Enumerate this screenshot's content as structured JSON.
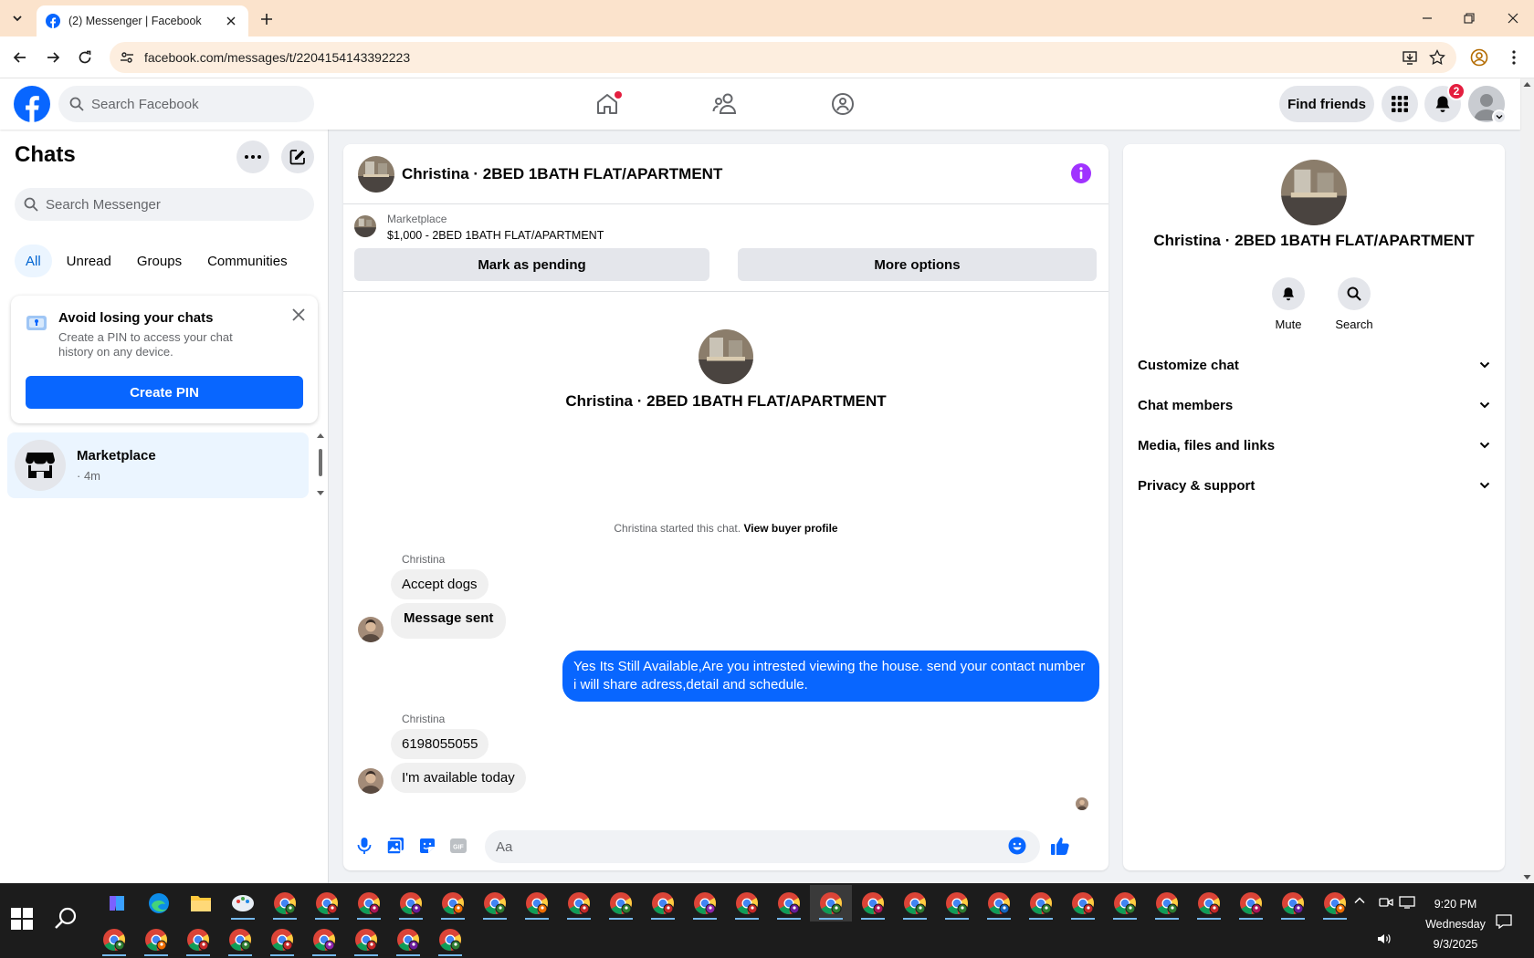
{
  "browser": {
    "tab_title": "(2) Messenger | Facebook",
    "url": "facebook.com/messages/t/2204154143392223"
  },
  "fb_header": {
    "search_placeholder": "Search Facebook",
    "find_friends": "Find friends",
    "notification_count": "2"
  },
  "chats": {
    "title": "Chats",
    "search_placeholder": "Search Messenger",
    "filters": [
      "All",
      "Unread",
      "Groups",
      "Communities"
    ],
    "pin_card": {
      "title": "Avoid losing your chats",
      "description": "Create a PIN to access your chat history on any device.",
      "button": "Create PIN"
    },
    "conversations": [
      {
        "name": "Marketplace",
        "time": "· 4m"
      }
    ]
  },
  "chat": {
    "header_name": "Christina · 2BED 1BATH FLAT/APARTMENT",
    "marketplace_label": "Marketplace",
    "listing": "$1,000 - 2BED 1BATH FLAT/APARTMENT",
    "mark_pending": "Mark as pending",
    "more_options": "More options",
    "intro_name": "Christina · 2BED 1BATH FLAT/APARTMENT",
    "started_text": "Christina started this chat.",
    "view_profile": "View buyer profile",
    "messages": [
      {
        "sender": "Christina",
        "text": "Accept dogs"
      },
      {
        "text": "Message sent"
      },
      {
        "outgoing": true,
        "text": "Yes Its Still Available,Are you intrested viewing the house. send your contact number i will share adress,detail and schedule."
      },
      {
        "sender": "Christina",
        "text": "6198055055"
      },
      {
        "text": "I'm available today"
      }
    ],
    "composer_placeholder": "Aa"
  },
  "info_panel": {
    "name": "Christina · 2BED 1BATH FLAT/APARTMENT",
    "actions": [
      "Mute",
      "Search"
    ],
    "sections": [
      "Customize chat",
      "Chat members",
      "Media, files and links",
      "Privacy & support"
    ]
  },
  "taskbar": {
    "time": "9:20 PM",
    "day": "Wednesday",
    "date": "9/3/2025"
  },
  "colors": {
    "fb_blue": "#0866ff",
    "accent_purple": "#a033ff",
    "badge_red": "#e41e3f"
  }
}
